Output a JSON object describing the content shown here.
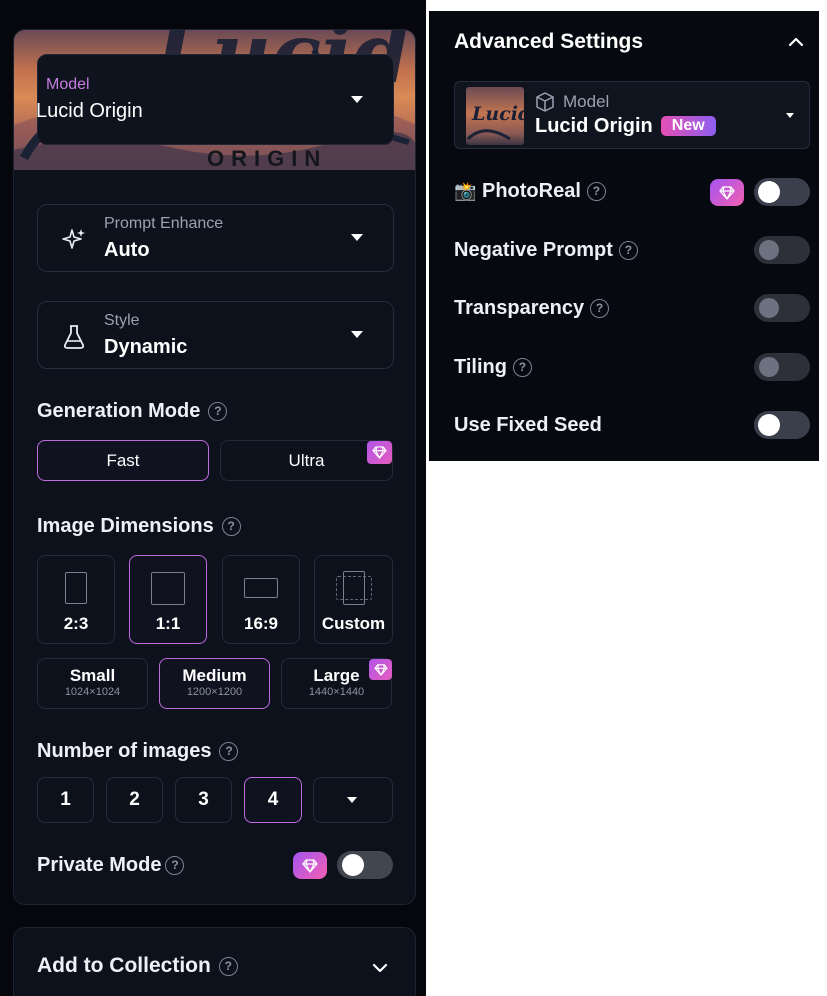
{
  "left_panel": {
    "model": {
      "banner_text": "Lucid",
      "banner_sub": "ORIGIN",
      "label": "Model",
      "value": "Lucid Origin"
    },
    "prompt_enhance": {
      "label": "Prompt Enhance",
      "value": "Auto"
    },
    "style": {
      "label": "Style",
      "value": "Dynamic"
    },
    "generation_mode": {
      "title": "Generation Mode",
      "help": "?",
      "options": [
        "Fast",
        "Ultra"
      ],
      "selected": "Fast"
    },
    "image_dimensions": {
      "title": "Image Dimensions",
      "help": "?",
      "ratios": [
        "2:3",
        "1:1",
        "16:9",
        "Custom"
      ],
      "selected_ratio": "1:1",
      "sizes": [
        {
          "label": "Small",
          "dims": "1024×1024"
        },
        {
          "label": "Medium",
          "dims": "1200×1200"
        },
        {
          "label": "Large",
          "dims": "1440×1440"
        }
      ],
      "selected_size": "Medium"
    },
    "number_of_images": {
      "title": "Number of images",
      "help": "?",
      "options": [
        "1",
        "2",
        "3",
        "4"
      ],
      "selected": "4"
    },
    "private_mode": {
      "label": "Private Mode",
      "help": "?",
      "enabled": false
    }
  },
  "collection": {
    "title": "Add to Collection",
    "help": "?"
  },
  "advanced_settings": {
    "title": "Advanced Settings",
    "model": {
      "thumb_text": "Lucid",
      "label": "Model",
      "value": "Lucid Origin",
      "badge": "New"
    },
    "toggles": [
      {
        "label": "PhotoReal",
        "emoji": "📸",
        "help": "?",
        "premium": true,
        "enabled": false
      },
      {
        "label": "Negative Prompt",
        "help": "?",
        "enabled": false
      },
      {
        "label": "Transparency",
        "help": "?",
        "enabled": false
      },
      {
        "label": "Tiling",
        "help": "?",
        "enabled": false
      },
      {
        "label": "Use Fixed Seed",
        "enabled": false
      }
    ]
  },
  "colors": {
    "accent": "#c06ae0",
    "panel": "#0c111c",
    "premium_gradient": [
      "#a455f2",
      "#f25fb0"
    ]
  }
}
